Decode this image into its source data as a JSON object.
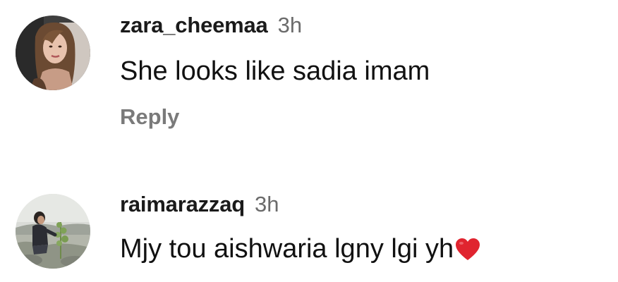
{
  "comments": [
    {
      "username": "zara_cheemaa",
      "time": "3h",
      "text": "She looks like sadia imam",
      "reply_label": "Reply",
      "avatar": "profile-photo-woman"
    },
    {
      "username": "raimarazzaq",
      "time": "3h",
      "text": "Mjy tou aishwaria lgny lgi yh",
      "emoji": "heart-icon",
      "avatar": "profile-photo-child-outdoors"
    }
  ],
  "colors": {
    "username": "#1a1a1a",
    "time": "#6b6b6b",
    "reply": "#7a7a7a",
    "heart": "#e0242f"
  }
}
